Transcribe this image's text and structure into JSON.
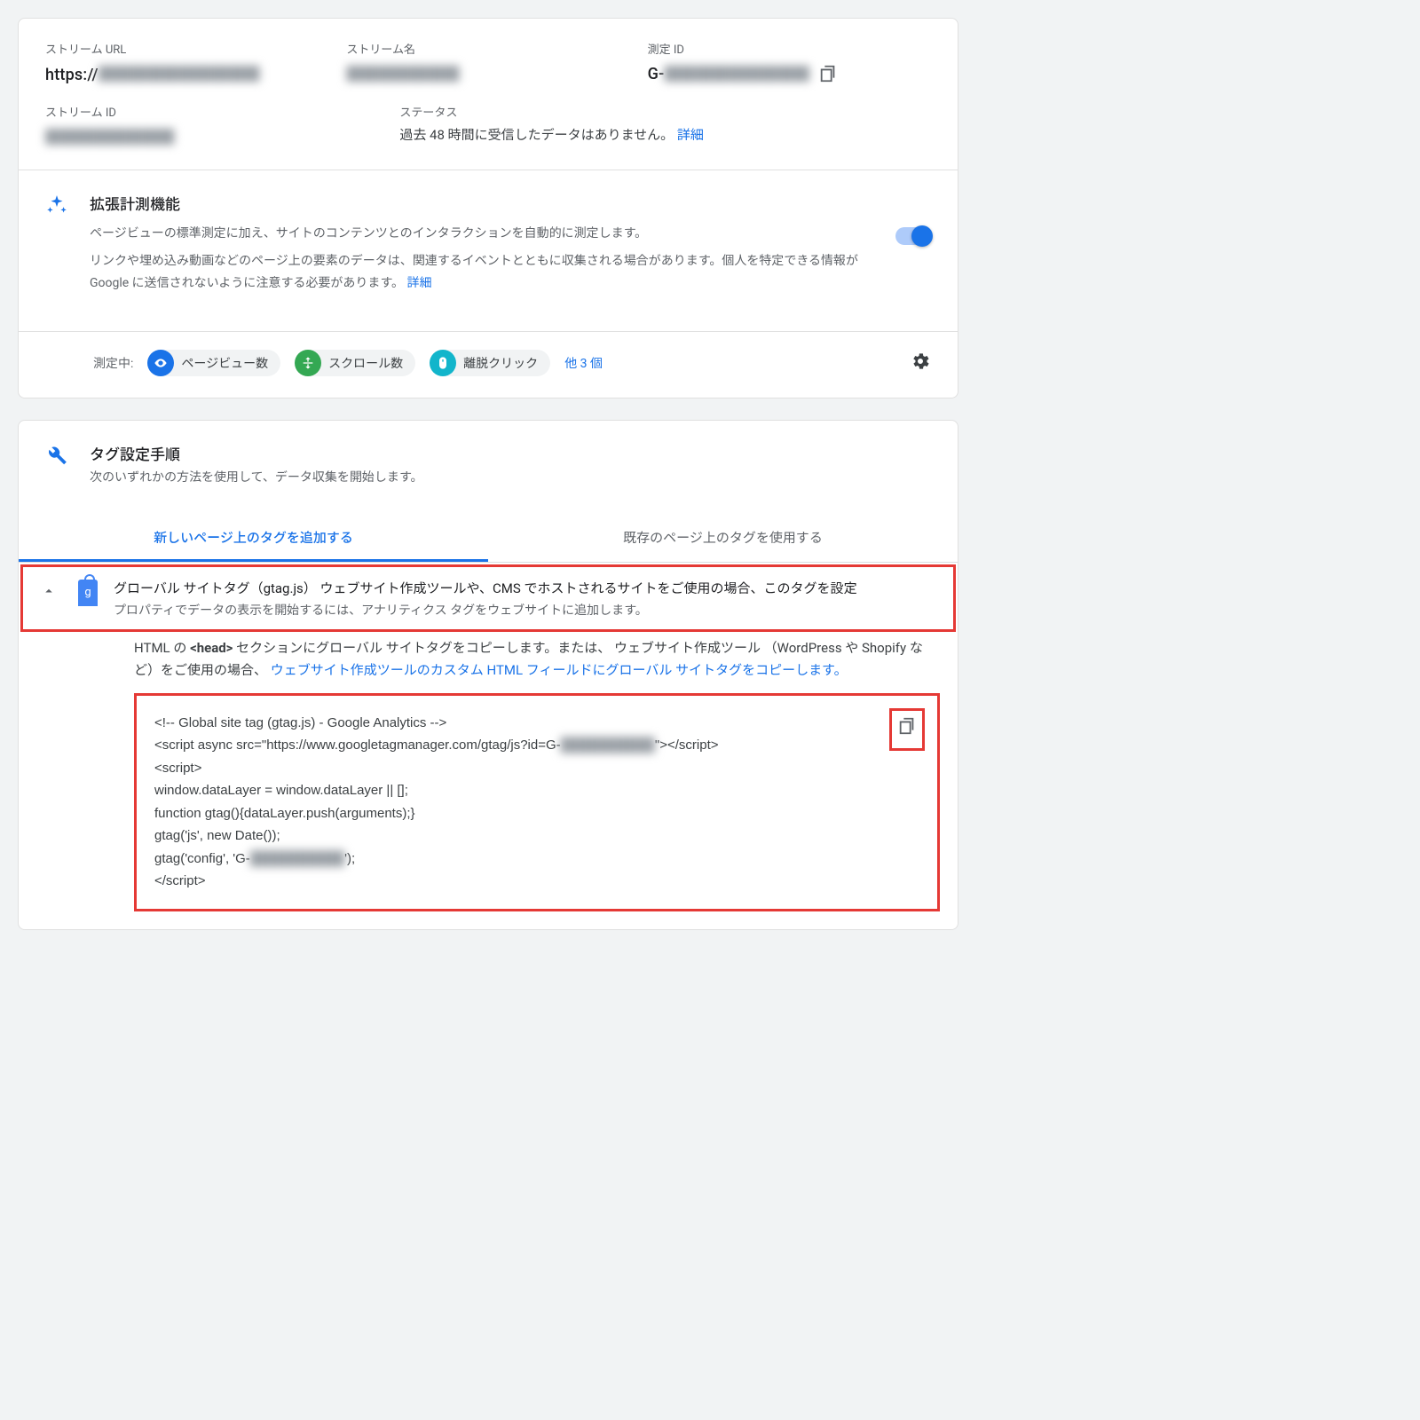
{
  "stream": {
    "url_label": "ストリーム URL",
    "url_prefix": "https://",
    "url_blur": "██████████",
    "name_label": "ストリーム名",
    "name_blur": "███████",
    "mid_label": "測定 ID",
    "mid_prefix": "G-",
    "mid_blur": "█████████",
    "id_label": "ストリーム ID",
    "id_blur": "████████",
    "status_label": "ステータス",
    "status_text": "過去 48 時間に受信したデータはありません。",
    "status_link": "詳細"
  },
  "enhanced": {
    "title": "拡張計測機能",
    "desc1": "ページビューの標準測定に加え、サイトのコンテンツとのインタラクションを自動的に測定します。",
    "desc2": "リンクや埋め込み動画などのページ上の要素のデータは、関連するイベントとともに収集される場合があります。個人を特定できる情報が Google に送信されないように注意する必要があります。",
    "desc_link": "詳細",
    "measuring_label": "測定中:",
    "chip1": "ページビュー数",
    "chip2": "スクロール数",
    "chip3": "離脱クリック",
    "more": "他 3 個"
  },
  "tag": {
    "title": "タグ設定手順",
    "sub": "次のいずれかの方法を使用して、データ収集を開始します。",
    "tab1": "新しいページ上のタグを追加する",
    "tab2": "既存のページ上のタグを使用する",
    "acc_title": "グローバル サイトタグ（gtag.js）  ウェブサイト作成ツールや、CMS でホストされるサイトをご使用の場合、このタグを設定",
    "acc_sub": "プロパティでデータの表示を開始するには、アナリティクス タグをウェブサイトに追加します。",
    "body_pre": "HTML の ",
    "body_head": "<head>",
    "body_mid": " セクションにグローバル サイトタグをコピーします。または、 ウェブサイト作成ツール （WordPress や Shopify など）をご使用の場合、",
    "body_link": "ウェブサイト作成ツールのカスタム HTML フィールドにグローバル サイトタグをコピーします。"
  },
  "code": {
    "l1": "<!-- Global site tag (gtag.js) - Google Analytics -->",
    "l2a": "<script async src=\"https://www.googletagmanager.com/gtag/js?id=G-",
    "l2b": "██████████",
    "l2c": "\"></script>",
    "l3": "<script>",
    "l4": "  window.dataLayer = window.dataLayer || [];",
    "l5": "  function gtag(){dataLayer.push(arguments);}",
    "l6": "  gtag('js', new Date());",
    "l7": "",
    "l8a": "  gtag('config', 'G-",
    "l8b": "██████████",
    "l8c": "');",
    "l9": "</script>"
  }
}
